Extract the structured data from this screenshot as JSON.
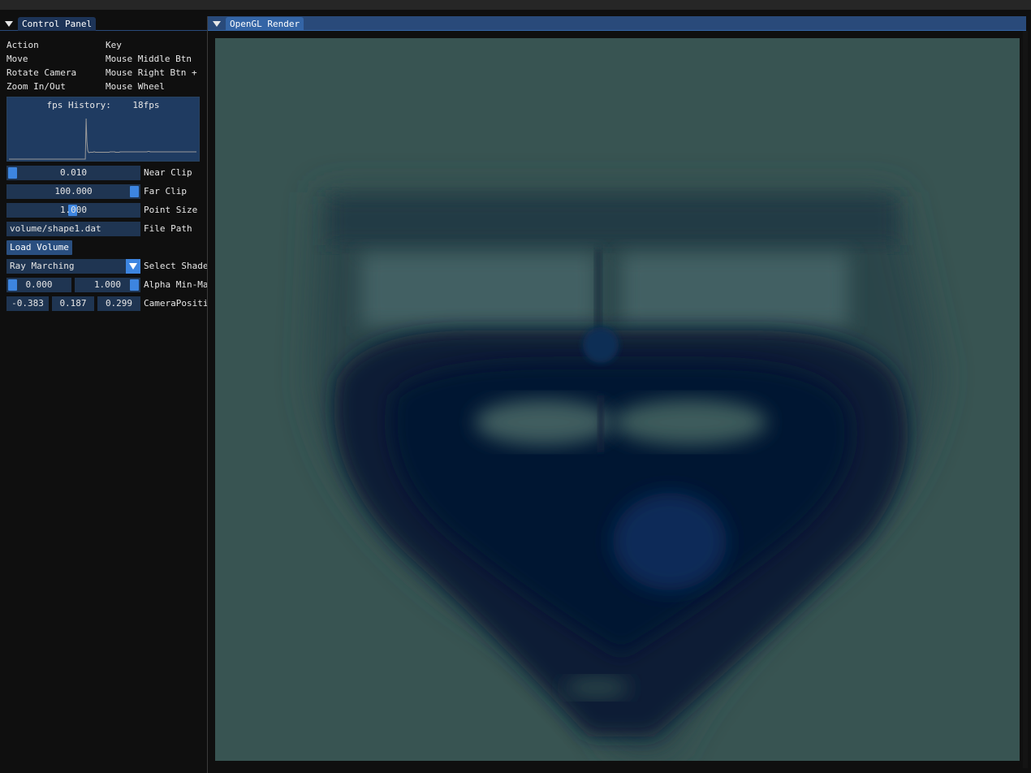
{
  "control_panel": {
    "title": "Control Panel",
    "keybinds": {
      "header": [
        "Action",
        "Key"
      ],
      "rows": [
        [
          "Move",
          "Mouse Middle Btn"
        ],
        [
          "Rotate Camera",
          "Mouse Right Btn +"
        ],
        [
          "Zoom In/Out",
          "Mouse Wheel"
        ]
      ]
    },
    "fps_history": {
      "label": "fps History:    18fps",
      "values": [
        0,
        0,
        0,
        0,
        0,
        0,
        0,
        0,
        0,
        0,
        0,
        0,
        0,
        0,
        0,
        0,
        0,
        0,
        0,
        0,
        0,
        0,
        0,
        0,
        0,
        0,
        0,
        0,
        0,
        0,
        0,
        0,
        0,
        0,
        0,
        0,
        0,
        0,
        0,
        0,
        0,
        0,
        0,
        0,
        0,
        0,
        0,
        0,
        0,
        0,
        0,
        0,
        0,
        0,
        0,
        0,
        0,
        0,
        0,
        0,
        0,
        0,
        0,
        0,
        0,
        0,
        0,
        0,
        0,
        0,
        0,
        0,
        0,
        0,
        0,
        0,
        0,
        0,
        0,
        0,
        0,
        0,
        0,
        0,
        0,
        0,
        0,
        0,
        0,
        0,
        0,
        0,
        0,
        0,
        0,
        0,
        0,
        0,
        0,
        0,
        100,
        45,
        22,
        17,
        16,
        17,
        17,
        17,
        17,
        17,
        18,
        18,
        17,
        17,
        17,
        17,
        17,
        17,
        17,
        17,
        17,
        17,
        17,
        17,
        17,
        17,
        17,
        17,
        17,
        17,
        17,
        18,
        18,
        18,
        18,
        18,
        18,
        18,
        17,
        17,
        17,
        17,
        17,
        17,
        18,
        18,
        18,
        18,
        18,
        18,
        18,
        18,
        18,
        18,
        18,
        18,
        18,
        18,
        18,
        18,
        18,
        18,
        18,
        18,
        18,
        18,
        18,
        18,
        18,
        18,
        18,
        18,
        18,
        18,
        18,
        18,
        18,
        18,
        18,
        18,
        19,
        19,
        19,
        18,
        18,
        18,
        18,
        18,
        18,
        18,
        18,
        18,
        18,
        18,
        18,
        18,
        18,
        18,
        18,
        18,
        18,
        18,
        18,
        18,
        18,
        18,
        18,
        18,
        18,
        18,
        18,
        18,
        18,
        18,
        18,
        18,
        18,
        18,
        18,
        18,
        18,
        18,
        18,
        18,
        18,
        18,
        18,
        18,
        18,
        18,
        18,
        18,
        18,
        18,
        18,
        18,
        18,
        18,
        18,
        18,
        18,
        18,
        18,
        18
      ],
      "max": 100
    },
    "near_clip": {
      "value": "0.010",
      "label": "Near Clip",
      "fraction": 0.0
    },
    "far_clip": {
      "value": "100.000",
      "label": "Far Clip",
      "fraction": 1.0
    },
    "point_size": {
      "value": "1.000",
      "label": "Point Size",
      "fraction": 0.49
    },
    "file_path": {
      "value": "volume/shape1.dat",
      "label": "File Path"
    },
    "load_button": "Load Volume",
    "shader": {
      "value": "Ray Marching",
      "label": "Select Shader"
    },
    "alpha": {
      "min": "0.000",
      "max": "1.000",
      "label": "Alpha Min-Max",
      "min_fraction": 0.0,
      "max_fraction": 1.0
    },
    "camera_position": {
      "x": "-0.383",
      "y": "0.187",
      "z": "0.299",
      "label": "CameraPosition"
    }
  },
  "render_window": {
    "title": "OpenGL Render"
  },
  "colors": {
    "accent": "#3d85e0",
    "frame_bg": "#1f3552",
    "title_active": "#294a7a",
    "viewport_bg": "#385452",
    "plot_line": "#9a9a9a"
  },
  "icons": {
    "collapse": "triangle-down-icon",
    "combo": "triangle-down-icon"
  }
}
